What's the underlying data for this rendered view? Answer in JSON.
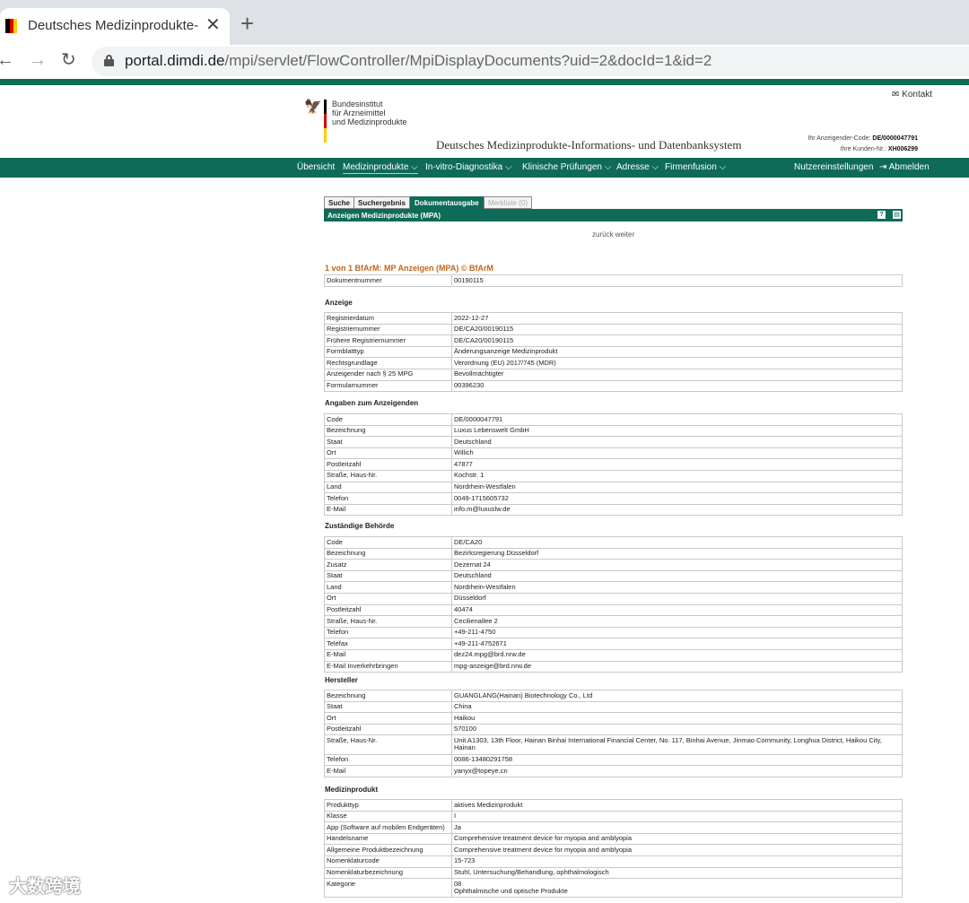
{
  "browser": {
    "tab_title": "Deutsches Medizinprodukte-Informations- und Datenbanksystem",
    "tab_close": "✕",
    "new_tab": "+",
    "url_host": "portal.dimdi.de",
    "url_path": "/mpi/servlet/FlowController/MpiDisplayDocuments?uid=2&docId=1&id=2"
  },
  "header": {
    "kontakt": "Kontakt",
    "logo_lines": [
      "Bundesinstitut",
      "für Arzneimittel",
      "und Medizinprodukte"
    ],
    "site_title": "Deutsches Medizinprodukte-Informations- und Datenbanksystem",
    "anzeigender_label": "Ihr Anzeigender-Code:",
    "anzeigender_value": "DE/0000047791",
    "kunden_label": "Ihre Kunden-Nr.:",
    "kunden_value": "XH006299"
  },
  "nav": {
    "items": [
      "Übersicht",
      "Medizinprodukte",
      "In-vitro-Diagnostika",
      "Klinische Prüfungen",
      "Adresse",
      "Firmenfusion"
    ],
    "right": [
      "Nutzereinstellungen",
      "Abmelden"
    ]
  },
  "subtabs": [
    "Suche",
    "Suchergebnis",
    "Dokumentausgabe",
    "Merkliste (0)"
  ],
  "section_header": "Anzeigen Medizinprodukte (MPA)",
  "pager": "zurück weiter",
  "doc_title": "1 von 1 BfArM: MP Anzeigen (MPA) © BfArM",
  "doc_number": [
    [
      "Dokumentnummer",
      "00190115"
    ]
  ],
  "groups": [
    {
      "title": "Anzeige",
      "rows": [
        [
          "Registrierdatum",
          "2022-12-27"
        ],
        [
          "Registriernummer",
          "DE/CA20/00190115"
        ],
        [
          "Frühere Registriernummer",
          "DE/CA20/00190115"
        ],
        [
          "Formblatttyp",
          "Änderungsanzeige Medizinprodukt"
        ],
        [
          "Rechtsgrundlage",
          "Verordnung (EU) 2017/745 (MDR)"
        ],
        [
          "Anzeigender nach § 25 MPG",
          "Bevollmächtigter"
        ],
        [
          "Formularnummer",
          "00396230"
        ]
      ]
    },
    {
      "title": "Angaben zum Anzeigenden",
      "rows": [
        [
          "Code",
          "DE/0000047791"
        ],
        [
          "Bezeichnung",
          "Luxus Lebenswelt GmbH"
        ],
        [
          "Staat",
          "Deutschland"
        ],
        [
          "Ort",
          "Willich"
        ],
        [
          "Postleitzahl",
          "47877"
        ],
        [
          "Straße, Haus-Nr.",
          "Kochstr. 1"
        ],
        [
          "Land",
          "Nordrhein-Westfalen"
        ],
        [
          "Telefon",
          "0049-1715605732"
        ],
        [
          "E-Mail",
          "info.m@luxuslw.de"
        ]
      ]
    },
    {
      "title": "Zuständige Behörde",
      "rows": [
        [
          "Code",
          "DE/CA20"
        ],
        [
          "Bezeichnung",
          "Bezirksregierung Düsseldorf"
        ],
        [
          "Zusatz",
          "Dezernat 24"
        ],
        [
          "Staat",
          "Deutschland"
        ],
        [
          "Land",
          "Nordrhein-Westfalen"
        ],
        [
          "Ort",
          "Düsseldorf"
        ],
        [
          "Postleitzahl",
          "40474"
        ],
        [
          "Straße, Haus-Nr.",
          "Cecilienallee 2"
        ],
        [
          "Telefon",
          "+49-211-4750"
        ],
        [
          "Telefax",
          "+49-211-4752671"
        ],
        [
          "E-Mail",
          "dez24.mpg@brd.nrw.de"
        ],
        [
          "E-Mail Inverkehrbringen",
          "mpg-anzeige@brd.nrw.de"
        ]
      ]
    },
    {
      "title": "Hersteller",
      "rows": [
        [
          "Bezeichnung",
          "GUANGLANG(Hainan) Biotechnology Co., Ltd"
        ],
        [
          "Staat",
          "China"
        ],
        [
          "Ort",
          "Haikou"
        ],
        [
          "Postleitzahl",
          "570100"
        ],
        [
          "Straße, Haus-Nr.",
          "Unit A1303, 13th Floor, Hainan Binhai International Financial Center, No. 117, Binhai Avenue, Jinmao Community, Longhua District, Haikou City, Hainan"
        ],
        [
          "Telefon",
          "0086-13480291758"
        ],
        [
          "E-Mail",
          "yanyx@topeye.cn"
        ]
      ]
    },
    {
      "title": "Medizinprodukt",
      "rows": [
        [
          "Produkttyp",
          "aktives Medizinprodukt"
        ],
        [
          "Klasse",
          "I"
        ],
        [
          "App (Software auf mobilen Endgeräten)",
          "Ja"
        ],
        [
          "Handelsname",
          "Comprehensive treatment device for myopia and amblyopia"
        ],
        [
          "Allgemeine Produktbezeichnung",
          "Comprehensive treatment device for myopia and amblyopia"
        ],
        [
          "Nomenklaturcode",
          "15-723"
        ],
        [
          "Nomenklaturbezeichnung",
          "Stuhl, Untersuchung/Behandlung, ophthalmologisch"
        ],
        [
          "Kategorie",
          "08\nOphthalmische und optische Produkte"
        ]
      ]
    }
  ],
  "watermark": "大数跨境"
}
